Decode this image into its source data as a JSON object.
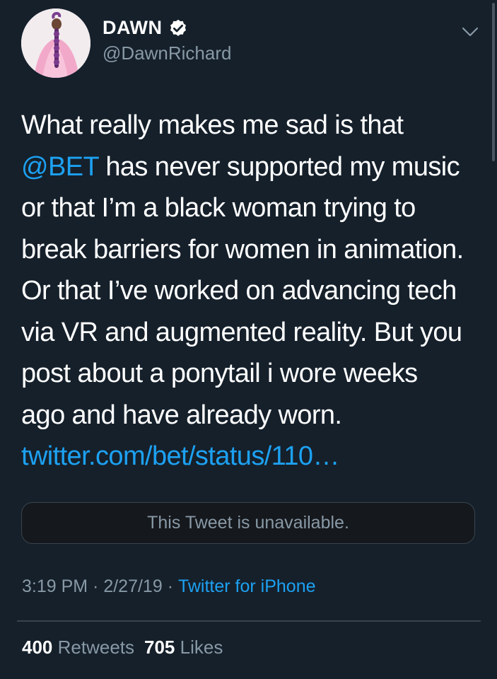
{
  "author": {
    "display_name": "DAWN",
    "handle": "@DawnRichard",
    "verified": true
  },
  "tweet": {
    "lines": [
      [
        {
          "text": "What really makes me sad is that",
          "type": "text"
        }
      ],
      [
        {
          "text": "@BET",
          "type": "mention"
        },
        {
          "text": " has never supported my music",
          "type": "text"
        }
      ],
      [
        {
          "text": "or that I’m a black woman trying to",
          "type": "text"
        }
      ],
      [
        {
          "text": "break barriers for women in animation.",
          "type": "text"
        }
      ],
      [
        {
          "text": "Or that I’ve worked on advancing tech",
          "type": "text"
        }
      ],
      [
        {
          "text": "via VR and augmented reality. But you",
          "type": "text"
        }
      ],
      [
        {
          "text": "post about a ponytail i wore weeks",
          "type": "text"
        }
      ],
      [
        {
          "text": "ago and have already worn.",
          "type": "text"
        }
      ],
      [
        {
          "text": "twitter.com/bet/status/110…",
          "type": "link"
        }
      ]
    ],
    "quoted": "This Tweet is unavailable.",
    "time": "3:19 PM",
    "date": "2/27/19",
    "separator": " · ",
    "source": "Twitter for iPhone"
  },
  "stats": {
    "retweets_count": "400",
    "retweets_label": "Retweets",
    "likes_count": "705",
    "likes_label": "Likes"
  },
  "colors": {
    "background": "#15202b",
    "link": "#1da1f2",
    "secondary_text": "#8899a6",
    "border": "#38444d"
  },
  "icons": [
    "verified-badge-icon",
    "chevron-down-icon"
  ]
}
